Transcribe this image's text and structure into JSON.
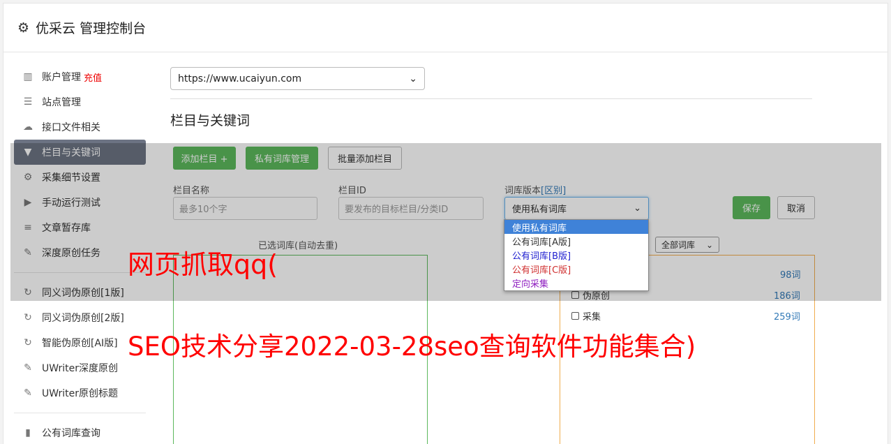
{
  "header": {
    "title": "优采云 管理控制台",
    "icon": "gear-icon"
  },
  "sidebar": {
    "items": [
      {
        "label": "账户管理",
        "extra": "充值",
        "icon": "bar-chart-icon"
      },
      {
        "label": "站点管理",
        "icon": "server-icon"
      },
      {
        "label": "接口文件相关",
        "icon": "cloud-upload-icon"
      },
      {
        "label": "栏目与关键词",
        "icon": "filter-icon",
        "active": true
      },
      {
        "label": "采集细节设置",
        "icon": "gears-icon"
      },
      {
        "label": "手动运行测试",
        "icon": "play-circle-icon"
      },
      {
        "label": "文章暂存库",
        "icon": "database-icon"
      },
      {
        "label": "深度原创任务",
        "icon": "edit-icon"
      }
    ],
    "items2": [
      {
        "label": "同义词伪原创[1版]",
        "icon": "refresh-icon"
      },
      {
        "label": "同义词伪原创[2版]",
        "icon": "refresh-icon"
      },
      {
        "label": "智能伪原创[AI版]",
        "icon": "refresh-icon"
      },
      {
        "label": "UWriter深度原创",
        "icon": "edit-icon"
      },
      {
        "label": "UWriter原创标题",
        "icon": "edit-icon"
      }
    ],
    "items3": [
      {
        "label": "公有词库查询",
        "icon": "book-icon"
      }
    ]
  },
  "main": {
    "site_select": "https://www.ucaiyun.com",
    "section_title": "栏目与关键词",
    "buttons": {
      "add_column": "添加栏目 +",
      "private_lib": "私有词库管理",
      "batch_add": "批量添加栏目",
      "save": "保存",
      "cancel": "取消"
    },
    "form": {
      "name_label": "栏目名称",
      "name_placeholder": "最多10个字",
      "id_label": "栏目ID",
      "id_placeholder": "要发布的目标栏目/分类ID",
      "version_label": "词库版本",
      "version_link": "[区别]",
      "version_value": "使用私有词库"
    },
    "selected_label": "已选词库(自动去重)",
    "filter_value": "全部词库",
    "libraries": [
      {
        "name": "",
        "count": "98词"
      },
      {
        "name": "伪原创",
        "count": "186词"
      },
      {
        "name": "采集",
        "count": "259词"
      }
    ],
    "dropdown_options": [
      {
        "label": "使用私有词库",
        "color": "#ffffff",
        "selected": true
      },
      {
        "label": "公有词库[A版]",
        "color": "#333333"
      },
      {
        "label": "公有词库[B版]",
        "color": "#2020d0"
      },
      {
        "label": "公有词库[C版]",
        "color": "#d03030"
      },
      {
        "label": "定向采集",
        "color": "#9020c0"
      }
    ]
  },
  "watermark": {
    "line1": "网页抓取qq(",
    "line2": "SEO技术分享2022-03-28seo查询软件功能集合)"
  }
}
